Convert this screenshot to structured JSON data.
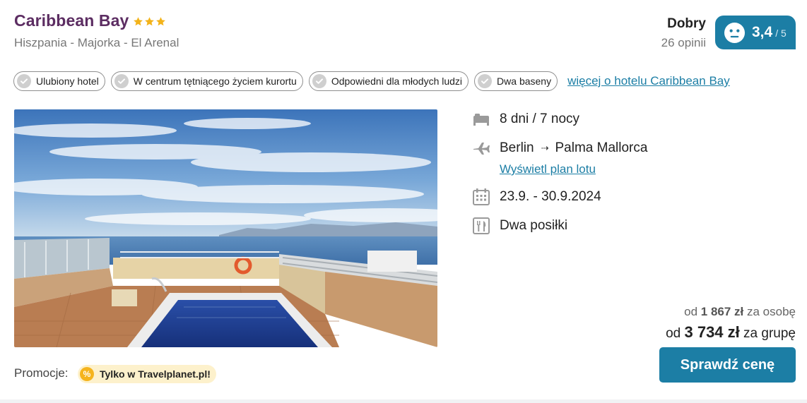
{
  "hotel": {
    "name": "Caribbean Bay",
    "stars": 3,
    "location": "Hiszpania - Majorka - El Arenal"
  },
  "rating": {
    "word": "Dobry",
    "count": "26 opinii",
    "score": "3,4",
    "max": "/ 5",
    "face_icon": "neutral-face-icon"
  },
  "tags": [
    {
      "label": "Ulubiony hotel"
    },
    {
      "label": "W centrum tętniącego życiem kurortu"
    },
    {
      "label": "Odpowiedni dla młodych ludzi"
    },
    {
      "label": "Dwa baseny"
    }
  ],
  "more_link": "więcej o hotelu Caribbean Bay",
  "details": {
    "duration": "8 dni / 7 nocy",
    "from": "Berlin",
    "arrow": "⇢",
    "to": "Palma Mallorca",
    "flight_plan_link": "Wyświetl plan lotu",
    "dates": "23.9. - 30.9.2024",
    "meals": "Dwa posiłki"
  },
  "price": {
    "per_person_prefix": "od",
    "per_person_amount": "1 867 zł",
    "per_person_suffix": "za osobę",
    "group_prefix": "od",
    "group_amount": "3 734 zł",
    "group_suffix": "za grupę"
  },
  "cta_label": "Sprawdź cenę",
  "promo": {
    "label": "Promocje:",
    "badge_icon": "%",
    "badge_text": "Tylko w Travelplanet.pl!"
  },
  "colors": {
    "brand_purple": "#5c2d62",
    "accent_blue": "#1c7ea5",
    "star_gold": "#f3b31a"
  }
}
